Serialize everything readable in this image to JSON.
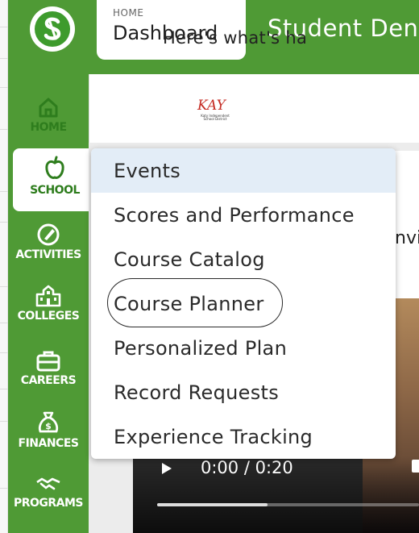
{
  "header": {
    "breadcrumb": "HOME",
    "page_title": "Dashboard",
    "app_title": "Student Den",
    "logo_icon": "naviance-s-logo"
  },
  "sidebar": {
    "items": [
      {
        "label": "HOME",
        "icon": "house-icon",
        "active": false
      },
      {
        "label": "SCHOOL",
        "icon": "apple-icon",
        "active": true
      },
      {
        "label": "ACTIVITIES",
        "icon": "pencil-icon",
        "active": false
      },
      {
        "label": "COLLEGES",
        "icon": "building-icon",
        "active": false
      },
      {
        "label": "CAREERS",
        "icon": "briefcase-icon",
        "active": false
      },
      {
        "label": "FINANCES",
        "icon": "money-bag-icon",
        "active": false
      },
      {
        "label": "PROGRAMS",
        "icon": "handshake-icon",
        "active": false
      }
    ]
  },
  "main": {
    "district_logo_text": "KAY",
    "district_logo_subtext": "Katy Independent School District",
    "banner_text": "Here's what's ha",
    "partial_text": "nvi",
    "video": {
      "time": "0:00 / 0:20",
      "progress": 0.42
    }
  },
  "school_menu": {
    "items": [
      "Events",
      "Scores and Performance",
      "Course Catalog",
      "Course Planner",
      "Personalized Plan",
      "Record Requests",
      "Experience Tracking"
    ],
    "hovered_index": 0,
    "circled_index": 3
  },
  "colors": {
    "brand_green": "#4f9a35",
    "active_green": "#2e7d1d",
    "hover_blue": "#e3edf7",
    "logo_red": "#c52b23"
  }
}
